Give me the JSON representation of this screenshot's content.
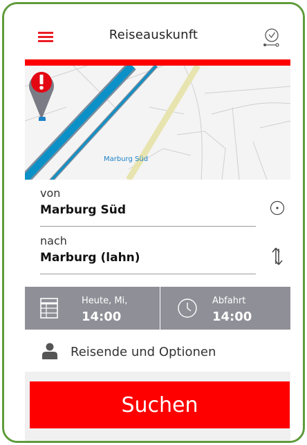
{
  "header": {
    "title": "Reiseauskunft",
    "menu_icon": "hamburger-menu-icon",
    "route_icon": "route-clock-icon"
  },
  "map": {
    "label": "Marburg Süd",
    "pin_icon": "warning-pin-icon"
  },
  "from": {
    "label": "von",
    "value": "Marburg Süd",
    "action_icon": "locate-target-icon"
  },
  "to": {
    "label": "nach",
    "value": "Marburg (lahn)",
    "action_icon": "swap-arrows-icon"
  },
  "date_tile": {
    "label": "Heute, Mi,",
    "value": "14:00",
    "icon": "calendar-icon"
  },
  "time_tile": {
    "label": "Abfahrt",
    "value": "14:00",
    "icon": "clock-icon"
  },
  "options": {
    "label": "Reisende und Optionen",
    "icon": "person-icon"
  },
  "search": {
    "label": "Suchen"
  },
  "colors": {
    "brand_red": "#ff0000",
    "frame_green": "#5e9b3a",
    "tile_gray": "#8f8f97",
    "map_road_blue": "#0b91c8",
    "map_rail": "#e8e4b0",
    "pin_red": "#e30613"
  }
}
